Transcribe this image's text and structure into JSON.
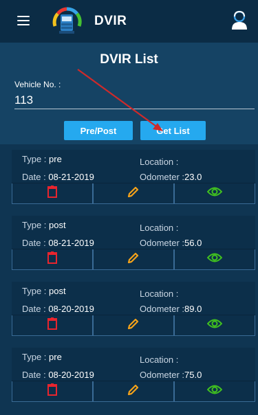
{
  "header": {
    "title": "DVIR"
  },
  "page": {
    "title": "DVIR List"
  },
  "vehicle": {
    "label": "Vehicle No. :",
    "value": "113"
  },
  "buttons": {
    "prepost": "Pre/Post",
    "getlist": "Get List"
  },
  "labels": {
    "type": "Type :",
    "date": "Date :",
    "location": "Location :",
    "odometer": "Odometer :"
  },
  "records": [
    {
      "type": "pre",
      "date": "08-21-2019",
      "location": "",
      "odometer": "23.0"
    },
    {
      "type": "post",
      "date": "08-21-2019",
      "location": "",
      "odometer": "56.0"
    },
    {
      "type": "post",
      "date": "08-20-2019",
      "location": "",
      "odometer": "89.0"
    },
    {
      "type": "pre",
      "date": "08-20-2019",
      "location": "",
      "odometer": "75.0"
    }
  ],
  "colors": {
    "delete": "#e8252e",
    "edit": "#f4a21a",
    "view": "#41c21f",
    "button": "#25a9ef"
  }
}
